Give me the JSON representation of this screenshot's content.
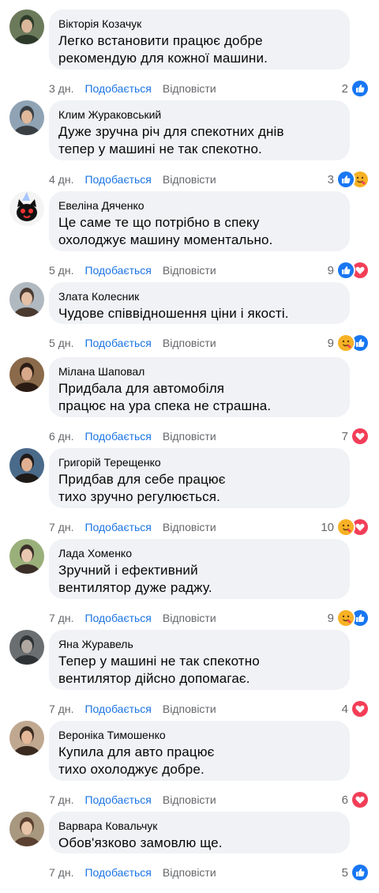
{
  "ui": {
    "like_label": "Подобається",
    "reply_label": "Відповісти"
  },
  "colors": {
    "bubble": "#f0f2f5",
    "link": "#1b74e4",
    "muted": "#65676b",
    "like": "#1877f2",
    "love": "#f33e58",
    "care": "#f7b125"
  },
  "comments": [
    {
      "author": "Вікторія Козачук",
      "lines": [
        "Легко встановити працює добре",
        "рекомендую для кожної машини."
      ],
      "time": "3 дн.",
      "count": "2",
      "reactions": [
        "like-icon"
      ]
    },
    {
      "author": "Клим Жураковський",
      "lines": [
        "Дуже зручна річ для спекотних днів",
        "тепер у машині не так спекотно."
      ],
      "time": "4 дн.",
      "count": "3",
      "reactions": [
        "like-icon",
        "care-icon"
      ]
    },
    {
      "author": "Евеліна Дяченко",
      "lines": [
        "Це саме те що потрібно в спеку",
        "охолоджує машину моментально."
      ],
      "time": "5 дн.",
      "count": "9",
      "reactions": [
        "like-icon",
        "love-icon"
      ]
    },
    {
      "author": "Злата Колесник",
      "lines": [
        "Чудове співвідношення ціни і якості."
      ],
      "time": "5 дн.",
      "count": "9",
      "reactions": [
        "care-icon",
        "like-icon"
      ]
    },
    {
      "author": "Мілана Шаповал",
      "lines": [
        "Придбала для автомобіля",
        "працює на ура спека не страшна."
      ],
      "time": "6 дн.",
      "count": "7",
      "reactions": [
        "love-icon"
      ]
    },
    {
      "author": "Григорій Терещенко",
      "lines": [
        "Придбав для себе працює",
        "тихо зручно регулюється."
      ],
      "time": "7 дн.",
      "count": "10",
      "reactions": [
        "care-icon",
        "love-icon"
      ]
    },
    {
      "author": "Лада Хоменко",
      "lines": [
        "Зручний і ефективний",
        "вентилятор дуже раджу."
      ],
      "time": "7 дн.",
      "count": "9",
      "reactions": [
        "care-icon",
        "like-icon"
      ]
    },
    {
      "author": "Яна Журавель",
      "lines": [
        "Тепер у машині не так спекотно",
        "вентилятор дійсно допомагає."
      ],
      "time": "7 дн.",
      "count": "4",
      "reactions": [
        "love-icon"
      ]
    },
    {
      "author": "Вероніка Тимошенко",
      "lines": [
        "Купила для авто працює",
        "тихо охолоджує добре."
      ],
      "time": "7 дн.",
      "count": "6",
      "reactions": [
        "love-icon"
      ]
    },
    {
      "author": "Варвара Ковальчук",
      "lines": [
        "Обов'язково замовлю ще."
      ],
      "time": "7 дн.",
      "count": "5",
      "reactions": [
        "like-icon"
      ]
    }
  ]
}
